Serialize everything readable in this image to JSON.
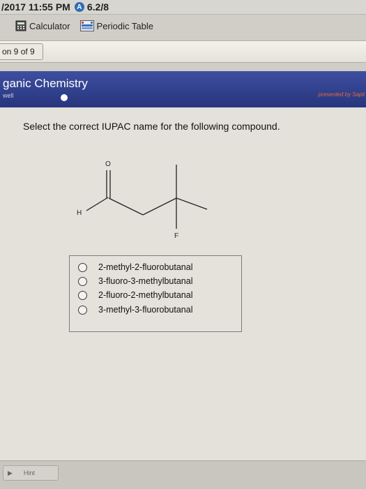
{
  "status": {
    "date": "/2017 11:55 PM",
    "score": "6.2/8"
  },
  "toolbar": {
    "calculator_label": "Calculator",
    "periodic_table_label": "Periodic Table"
  },
  "nav": {
    "question_counter": "on 9 of 9"
  },
  "header": {
    "title": "ganic Chemistry",
    "subtitle": "well",
    "presented_by": "presented by Sapli"
  },
  "question": {
    "prompt": "Select the correct IUPAC name for the following compound.",
    "molecule_labels": {
      "oxygen": "O",
      "hydrogen": "H",
      "fluorine": "F"
    },
    "choices": [
      "2-methyl-2-fluorobutanal",
      "3-fluoro-3-methylbutanal",
      "2-fluoro-2-methylbutanal",
      "3-methyl-3-fluorobutanal"
    ]
  },
  "footer": {
    "hint_label": "Hint"
  }
}
